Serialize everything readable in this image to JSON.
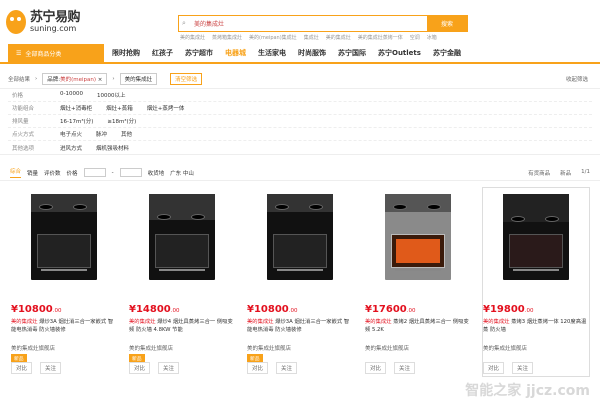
{
  "header": {
    "logo_cn": "苏宁易购",
    "logo_en": "suning.com",
    "search_value": "美的集成灶",
    "search_button": "搜索",
    "hot_words": [
      "美的集成灶",
      "蒸烤箱集成灶",
      "美的(meipan)集成灶",
      "集成灶",
      "美的集成灶",
      "美的集成灶蒸烤一体",
      "空调",
      "冰箱"
    ]
  },
  "nav": {
    "category_label": "全部商品分类",
    "items": [
      "限时抢购",
      "红孩子",
      "苏宁超市",
      "电器城",
      "生活家电",
      "时尚服饰",
      "苏宁国际",
      "苏宁Outlets",
      "苏宁金融"
    ]
  },
  "crumb": {
    "all": "全部结果",
    "brand_label": "品牌:",
    "brand_value": "美的(meipan)",
    "keyword": "美的集成灶",
    "clear": "清空筛选",
    "collapse": "收起筛选"
  },
  "filters": [
    {
      "label": "价格",
      "values": [
        "0-10000",
        "10000以上"
      ]
    },
    {
      "label": "功能组合",
      "values": [
        "烟灶+消毒柜",
        "烟灶+蒸箱",
        "烟灶+蒸烤一体"
      ]
    },
    {
      "label": "排风量",
      "values": [
        "16-17m³(分)",
        "≥18m³(分)"
      ]
    },
    {
      "label": "点火方式",
      "values": [
        "电子点火",
        "脉冲",
        "其他"
      ]
    },
    {
      "label": "其他选项",
      "values": [
        "进风方式",
        "烟机强吸材料"
      ]
    }
  ],
  "sortbar": {
    "items": [
      "综合",
      "销量",
      "评价数",
      "价格"
    ],
    "delivery_label": "收货地",
    "delivery_value": "广东 中山",
    "stock": "有货商品",
    "new": "新品",
    "page": "1/1"
  },
  "products": [
    {
      "price": "10800",
      "cents": ".00",
      "title_brand": "美的集成灶",
      "title": "爆炒3A 烟灶消三合一家嵌式 智能电热消毒 防火墙装修",
      "shop": "美的集成灶旗舰店",
      "badge": "新品",
      "compare": "对比",
      "follow": "关注"
    },
    {
      "price": "14800",
      "cents": ".00",
      "title_brand": "美的集成灶",
      "title": "爆炒4 烟灶具蒸烤三合一 侧吸变频 防火墙 4.8KW 节能",
      "shop": "美的集成灶旗舰店",
      "badge": "新品",
      "compare": "对比",
      "follow": "关注"
    },
    {
      "price": "10800",
      "cents": ".00",
      "title_brand": "美的集成灶",
      "title": "爆炒3A 烟灶消三合一家嵌式 智能电热消毒 防火墙装修",
      "shop": "美的集成灶旗舰店",
      "badge": "新品",
      "compare": "对比",
      "follow": "关注"
    },
    {
      "price": "17600",
      "cents": ".00",
      "title_brand": "美的集成灶",
      "title": "蒸烤2 烟灶具蒸烤三合一 侧吸变频 5.2K",
      "shop": "美的集成灶旗舰店",
      "badge": "",
      "compare": "对比",
      "follow": "关注"
    },
    {
      "price": "19800",
      "cents": ".00",
      "title_brand": "美的集成灶",
      "title": "蒸烤3 烟灶蒸烤一体 120度高温蒸 防火墙",
      "shop": "美的集成灶旗舰店",
      "badge": "",
      "compare": "对比",
      "follow": "关注"
    }
  ],
  "watermark": "智能之家 jjcz.com"
}
